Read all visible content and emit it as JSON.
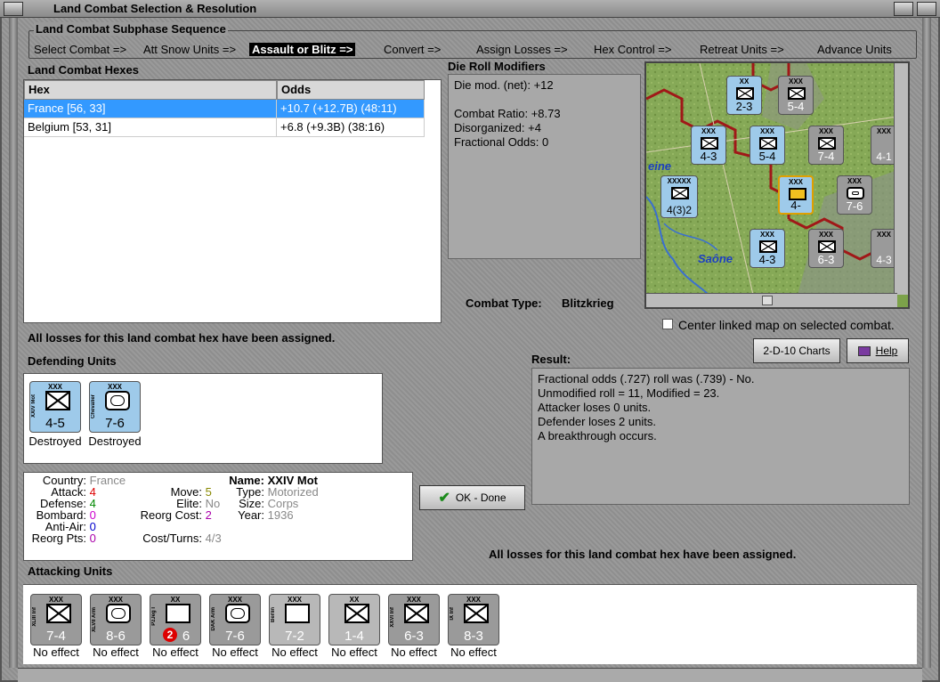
{
  "window": {
    "title": "Land Combat Selection & Resolution"
  },
  "sequence": {
    "title": "Land Combat Subphase Sequence",
    "steps": [
      "Select Combat =>",
      "Att Snow Units =>",
      "Assault or Blitz =>",
      "Convert =>",
      "Assign Losses =>",
      "Hex Control =>",
      "Retreat Units =>",
      "Advance Units"
    ],
    "active_index": 2
  },
  "hexes": {
    "title": "Land Combat Hexes",
    "columns": [
      "Hex",
      "Odds"
    ],
    "rows": [
      {
        "hex": "France [56, 33]",
        "odds": "+10.7 (+12.7B) (48:11)"
      },
      {
        "hex": "Belgium [53, 31]",
        "odds": "+6.8 (+9.3B) (38:16)"
      }
    ]
  },
  "modifiers": {
    "title": "Die Roll Modifiers",
    "lines": [
      "Die mod. (net): +12",
      "",
      "Combat Ratio: +8.73",
      "Disorganized: +4",
      "Fractional Odds: 0"
    ]
  },
  "map": {
    "labels": [
      "eine",
      "Saône"
    ],
    "counters": [
      {
        "size": "XX",
        "str": "2-3"
      },
      {
        "size": "XXX",
        "str": "5-4"
      },
      {
        "size": "XXX",
        "str": "4-3"
      },
      {
        "size": "XXX",
        "str": "5-4"
      },
      {
        "size": "XXX",
        "str": "7-4"
      },
      {
        "size": "XXXXX",
        "str": "4(3)2"
      },
      {
        "size": "XXX",
        "str": "4-"
      },
      {
        "size": "XXX",
        "str": "7-6"
      },
      {
        "size": "XXX",
        "str": "4-3"
      },
      {
        "size": "XXX",
        "str": "6-3"
      },
      {
        "size": "XXX",
        "str": "4-1"
      },
      {
        "size": "XXX",
        "str": "4-3"
      }
    ]
  },
  "combat_type": {
    "label": "Combat Type:",
    "value": "Blitzkrieg"
  },
  "center_map": {
    "label": "Center linked map on selected combat.",
    "checked": false
  },
  "losses_msg": "All losses for this land combat hex have been assigned.",
  "buttons": {
    "charts": "2-D-10 Charts",
    "help": "Help",
    "done": "OK - Done"
  },
  "defending": {
    "title": "Defending Units",
    "units": [
      {
        "name": "XXIV Mot",
        "size": "XXX",
        "str": "4-5",
        "status": "Destroyed"
      },
      {
        "name": "Chevalier",
        "size": "XXX",
        "str": "7-6",
        "status": "Destroyed"
      }
    ]
  },
  "result": {
    "title": "Result:",
    "lines": [
      "Fractional odds (.727) roll was (.739)  - No.",
      "Unmodified roll = 11, Modified = 23.",
      "Attacker loses 0 units.",
      "Defender loses 2 units.",
      "A breakthrough occurs."
    ]
  },
  "unit_info": {
    "country_label": "Country:",
    "country": "France",
    "attack_label": "Attack:",
    "attack": "4",
    "defense_label": "Defense:",
    "defense": "4",
    "bombard_label": "Bombard:",
    "bombard": "0",
    "antiair_label": "Anti-Air:",
    "antiair": "0",
    "reorg_pts_label": "Reorg Pts:",
    "reorg_pts": "0",
    "move_label": "Move:",
    "move": "5",
    "elite_label": "Elite:",
    "elite": "No",
    "reorg_cost_label": "Reorg Cost:",
    "reorg_cost": "2",
    "cost_turns_label": "Cost/Turns:",
    "cost_turns": "4/3",
    "name_label": "Name:",
    "name": "XXIV Mot",
    "type_label": "Type:",
    "type": "Motorized",
    "size_label": "Size:",
    "size": "Corps",
    "year_label": "Year:",
    "year": "1936"
  },
  "attacking": {
    "title": "Attacking Units",
    "units": [
      {
        "name": "XLIII Inf",
        "size": "XXX",
        "str": "7-4",
        "status": "No effect"
      },
      {
        "name": "XLVII Arm",
        "size": "XXX",
        "str": "8-6",
        "status": "No effect"
      },
      {
        "name": "PzJeg I",
        "size": "XX",
        "str": "6",
        "badge": "2",
        "status": "No effect"
      },
      {
        "name": "DAK Arm",
        "size": "XXX",
        "str": "7-6",
        "status": "No effect"
      },
      {
        "name": "Berlin",
        "size": "XXX",
        "str": "7-2",
        "status": "No effect"
      },
      {
        "name": "",
        "size": "XX",
        "str": "1-4",
        "status": "No effect"
      },
      {
        "name": "XXVI Inf",
        "size": "XXX",
        "str": "6-3",
        "status": "No effect"
      },
      {
        "name": "IX Inf",
        "size": "XXX",
        "str": "8-3",
        "status": "No effect"
      }
    ]
  }
}
